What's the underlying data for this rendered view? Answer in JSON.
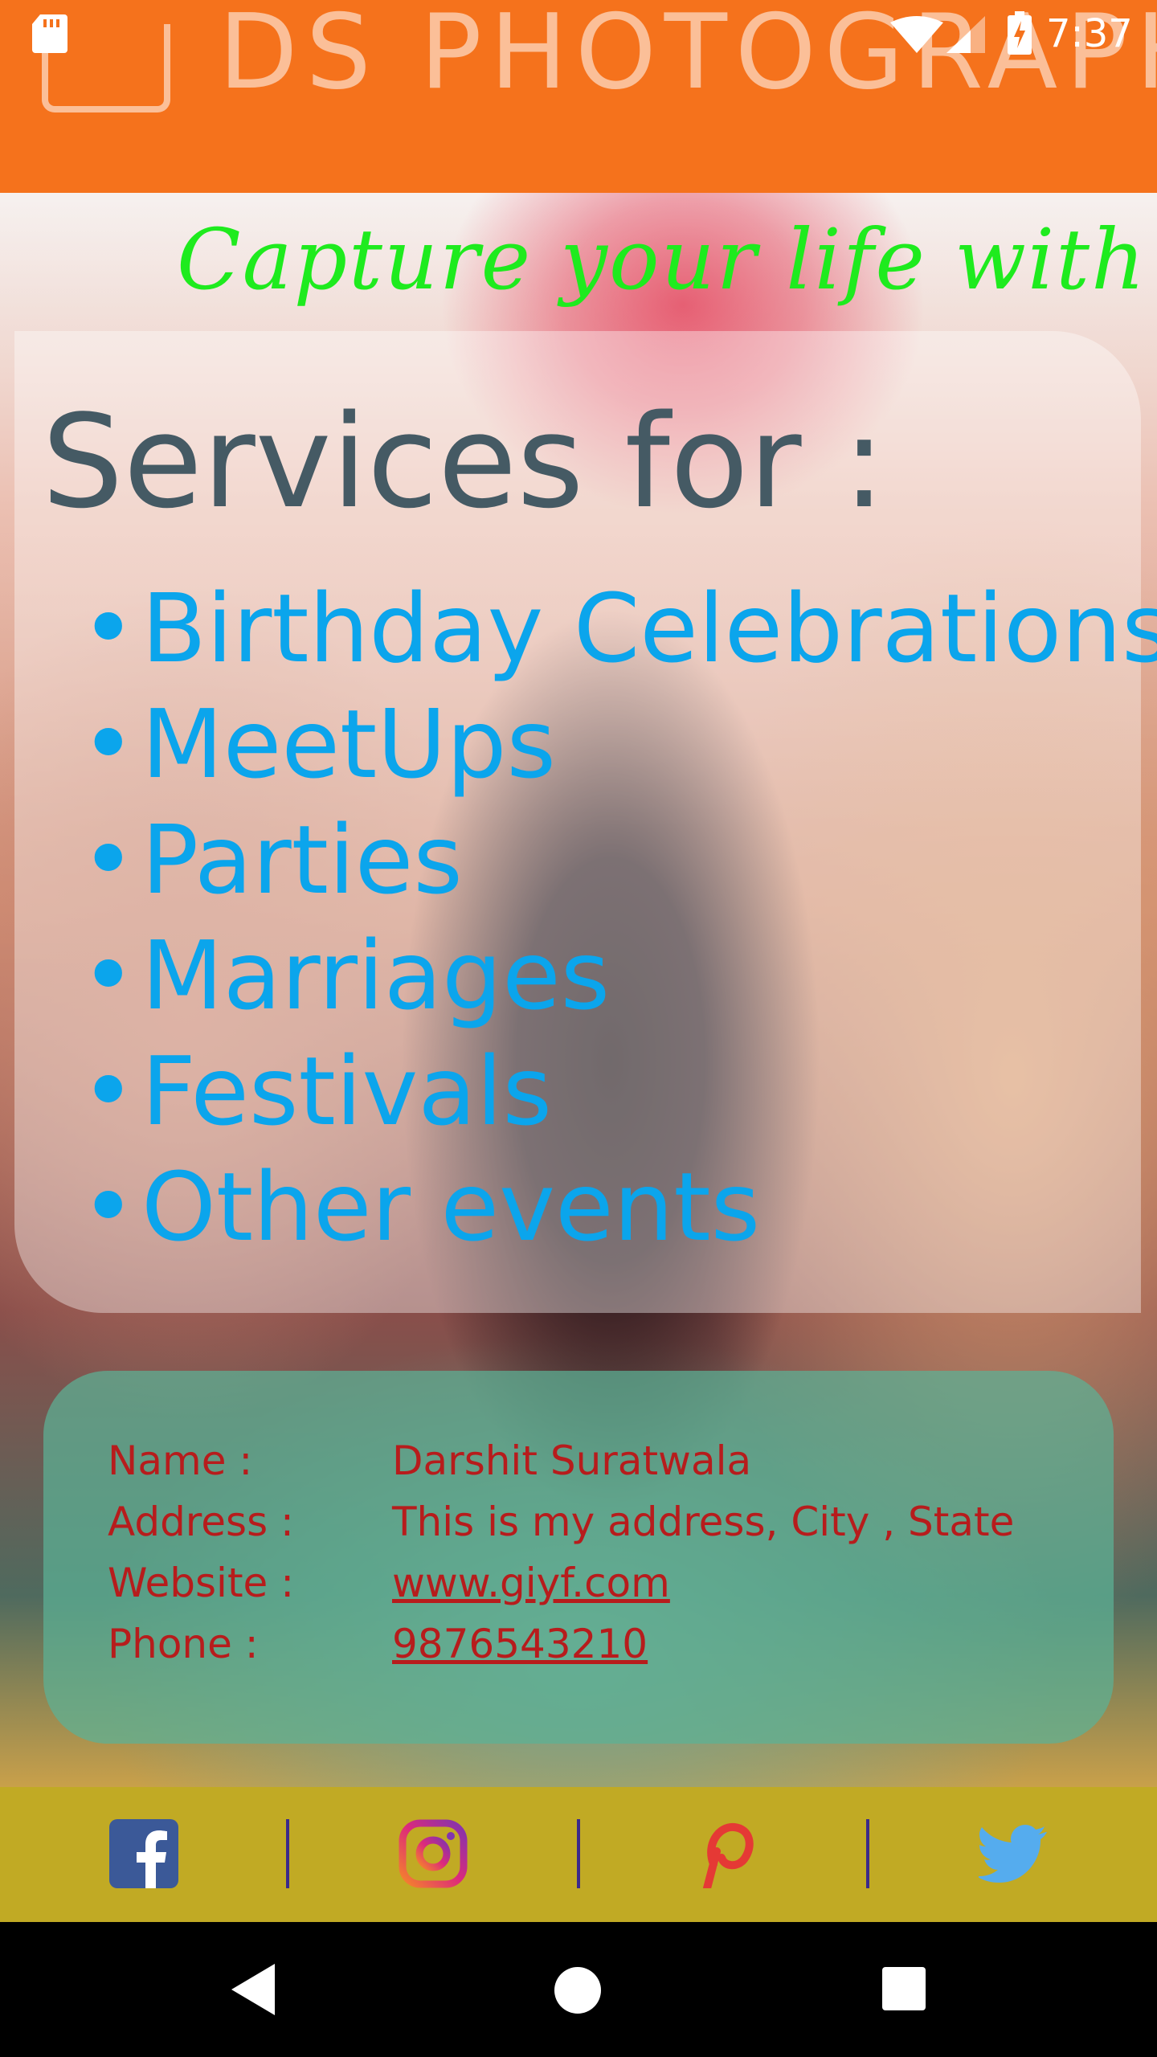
{
  "status_bar": {
    "time": "7:37",
    "icons": [
      "sd-card-icon",
      "wifi-icon",
      "signal-icon",
      "battery-charging-icon"
    ]
  },
  "app_bar": {
    "title": "DS PHOTOGRAPHY",
    "background_color": "#F5721C"
  },
  "hero": {
    "tagline": "Capture your life with US",
    "tagline_color": "#1EEB1E"
  },
  "services": {
    "heading": "Services for :",
    "bullet": "•",
    "items": [
      "Birthday Celebrations",
      "MeetUps",
      "Parties",
      "Marriages",
      "Festivals",
      "Other events"
    ],
    "item_color": "#0BA5EC"
  },
  "contact": {
    "rows": [
      {
        "label": "Name :",
        "value": "Darshit Suratwala"
      },
      {
        "label": "Address :",
        "value": "This is my address, City , State"
      },
      {
        "label": "Website :",
        "value": "www.giyf.com"
      },
      {
        "label": "Phone :",
        "value": "9876543210"
      }
    ],
    "text_color": "#B71C1C"
  },
  "social": {
    "icons": [
      "facebook-icon",
      "instagram-icon",
      "pinterest-icon",
      "twitter-icon"
    ]
  },
  "nav_bar": {
    "icons": [
      "back-icon",
      "home-icon",
      "recents-icon"
    ]
  }
}
